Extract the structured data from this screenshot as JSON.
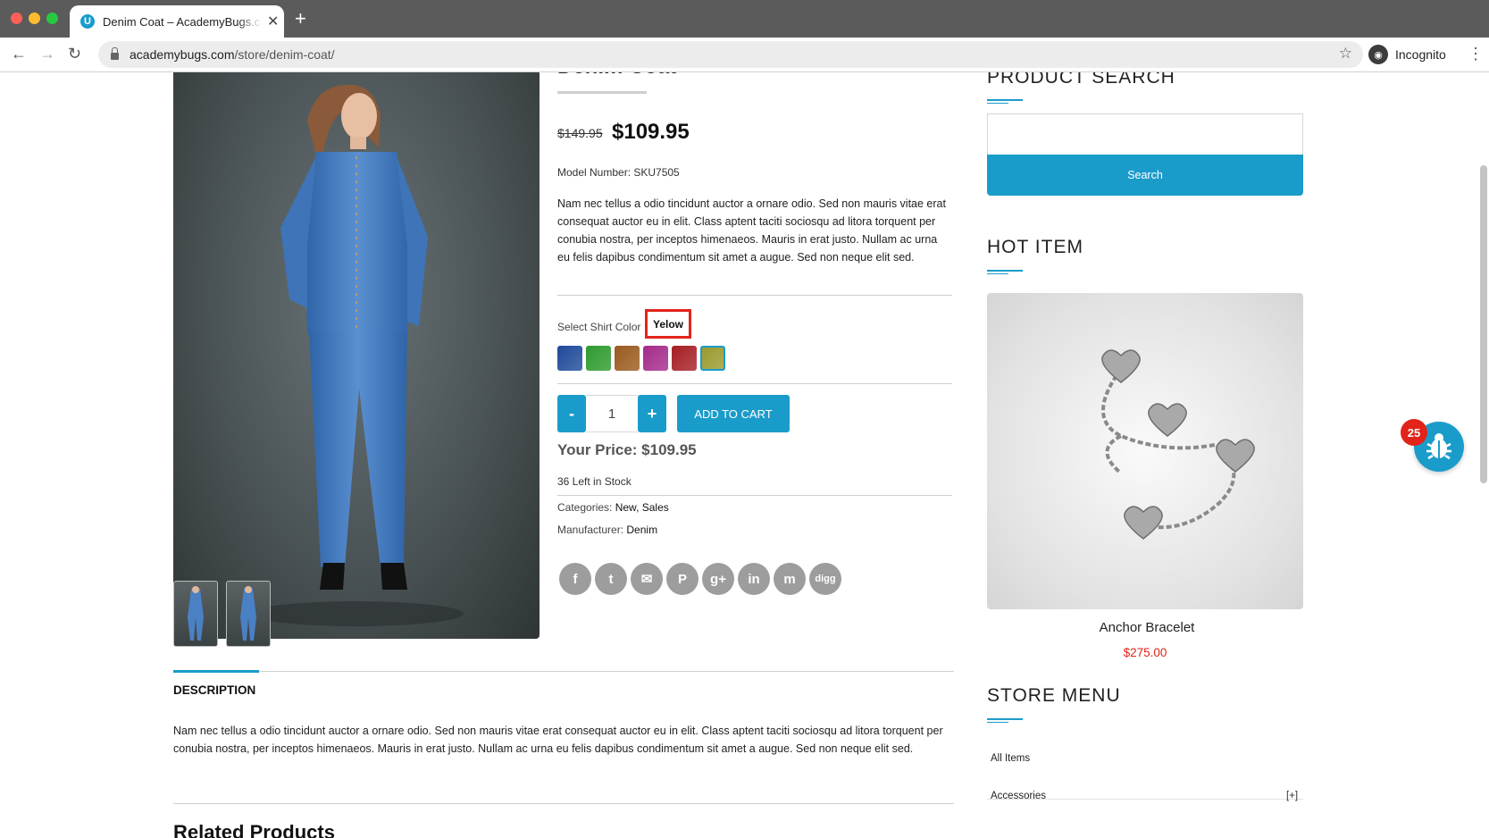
{
  "browser": {
    "tab_title": "Denim Coat – AcademyBugs.com",
    "tab_favicon_letter": "U",
    "url_domain": "academybugs.com",
    "url_path": "/store/denim-coat/",
    "incognito_label": "Incognito"
  },
  "product": {
    "title": "Denim Coat",
    "old_price": "$149.95",
    "price": "$109.95",
    "model": "Model Number: SKU7505",
    "description": "Nam nec tellus a odio tincidunt auctor a ornare odio. Sed non mauris vitae erat consequat auctor eu in elit. Class aptent taciti sociosqu ad litora torquent per conubia nostra, per inceptos himenaeos. Mauris in erat justo. Nullam ac urna eu felis dapibus condimentum sit amet a augue. Sed non neque elit sed.",
    "color_label": "Select Shirt Color",
    "selected_color": "Yelow",
    "swatches": [
      {
        "name": "blue",
        "color": "#1e4a9a"
      },
      {
        "name": "green",
        "color": "#2e9a2e"
      },
      {
        "name": "brown",
        "color": "#9a5a1e"
      },
      {
        "name": "magenta",
        "color": "#a52a8a"
      },
      {
        "name": "red",
        "color": "#a51e24"
      },
      {
        "name": "yellow",
        "color": "#9a9a2e"
      }
    ],
    "qty_minus": "-",
    "qty": "1",
    "qty_plus": "+",
    "add_to_cart": "ADD TO CART",
    "your_price": "Your Price: $109.95",
    "stock": "36 Left in Stock",
    "categories_label": "Categories:",
    "categories_value": "New, Sales",
    "manufacturer_label": "Manufacturer:",
    "manufacturer_value": "Denim",
    "social": [
      {
        "icon": "facebook-icon",
        "glyph": "f"
      },
      {
        "icon": "twitter-icon",
        "glyph": "t"
      },
      {
        "icon": "email-icon",
        "glyph": "✉"
      },
      {
        "icon": "pinterest-icon",
        "glyph": "P"
      },
      {
        "icon": "google-plus-icon",
        "glyph": "g+"
      },
      {
        "icon": "linkedin-icon",
        "glyph": "in"
      },
      {
        "icon": "myspace-icon",
        "glyph": "m"
      },
      {
        "icon": "digg-icon",
        "glyph": "digg"
      }
    ]
  },
  "tabs": {
    "description_label": "DESCRIPTION",
    "description_text": "Nam nec tellus a odio tincidunt auctor a ornare odio. Sed non mauris vitae erat consequat auctor eu in elit. Class aptent taciti sociosqu ad litora torquent per conubia nostra, per inceptos himenaeos. Mauris in erat justo. Nullam ac urna eu felis dapibus condimentum sit amet a augue. Sed non neque elit sed."
  },
  "related_title": "Related Products",
  "sidebar": {
    "search_title": "PRODUCT SEARCH",
    "search_button": "Search",
    "hot_title": "HOT ITEM",
    "hot_name": "Anchor Bracelet",
    "hot_price": "$275.00",
    "menu_title": "STORE MENU",
    "menu_items": [
      {
        "label": "All Items",
        "expand": ""
      },
      {
        "label": "Accessories",
        "expand": "[+]"
      }
    ]
  },
  "bug_widget": {
    "count": "25"
  },
  "colors": {
    "accent": "#1a9ccb",
    "highlight": "#e2231a",
    "sale_price": "#e2231a"
  }
}
